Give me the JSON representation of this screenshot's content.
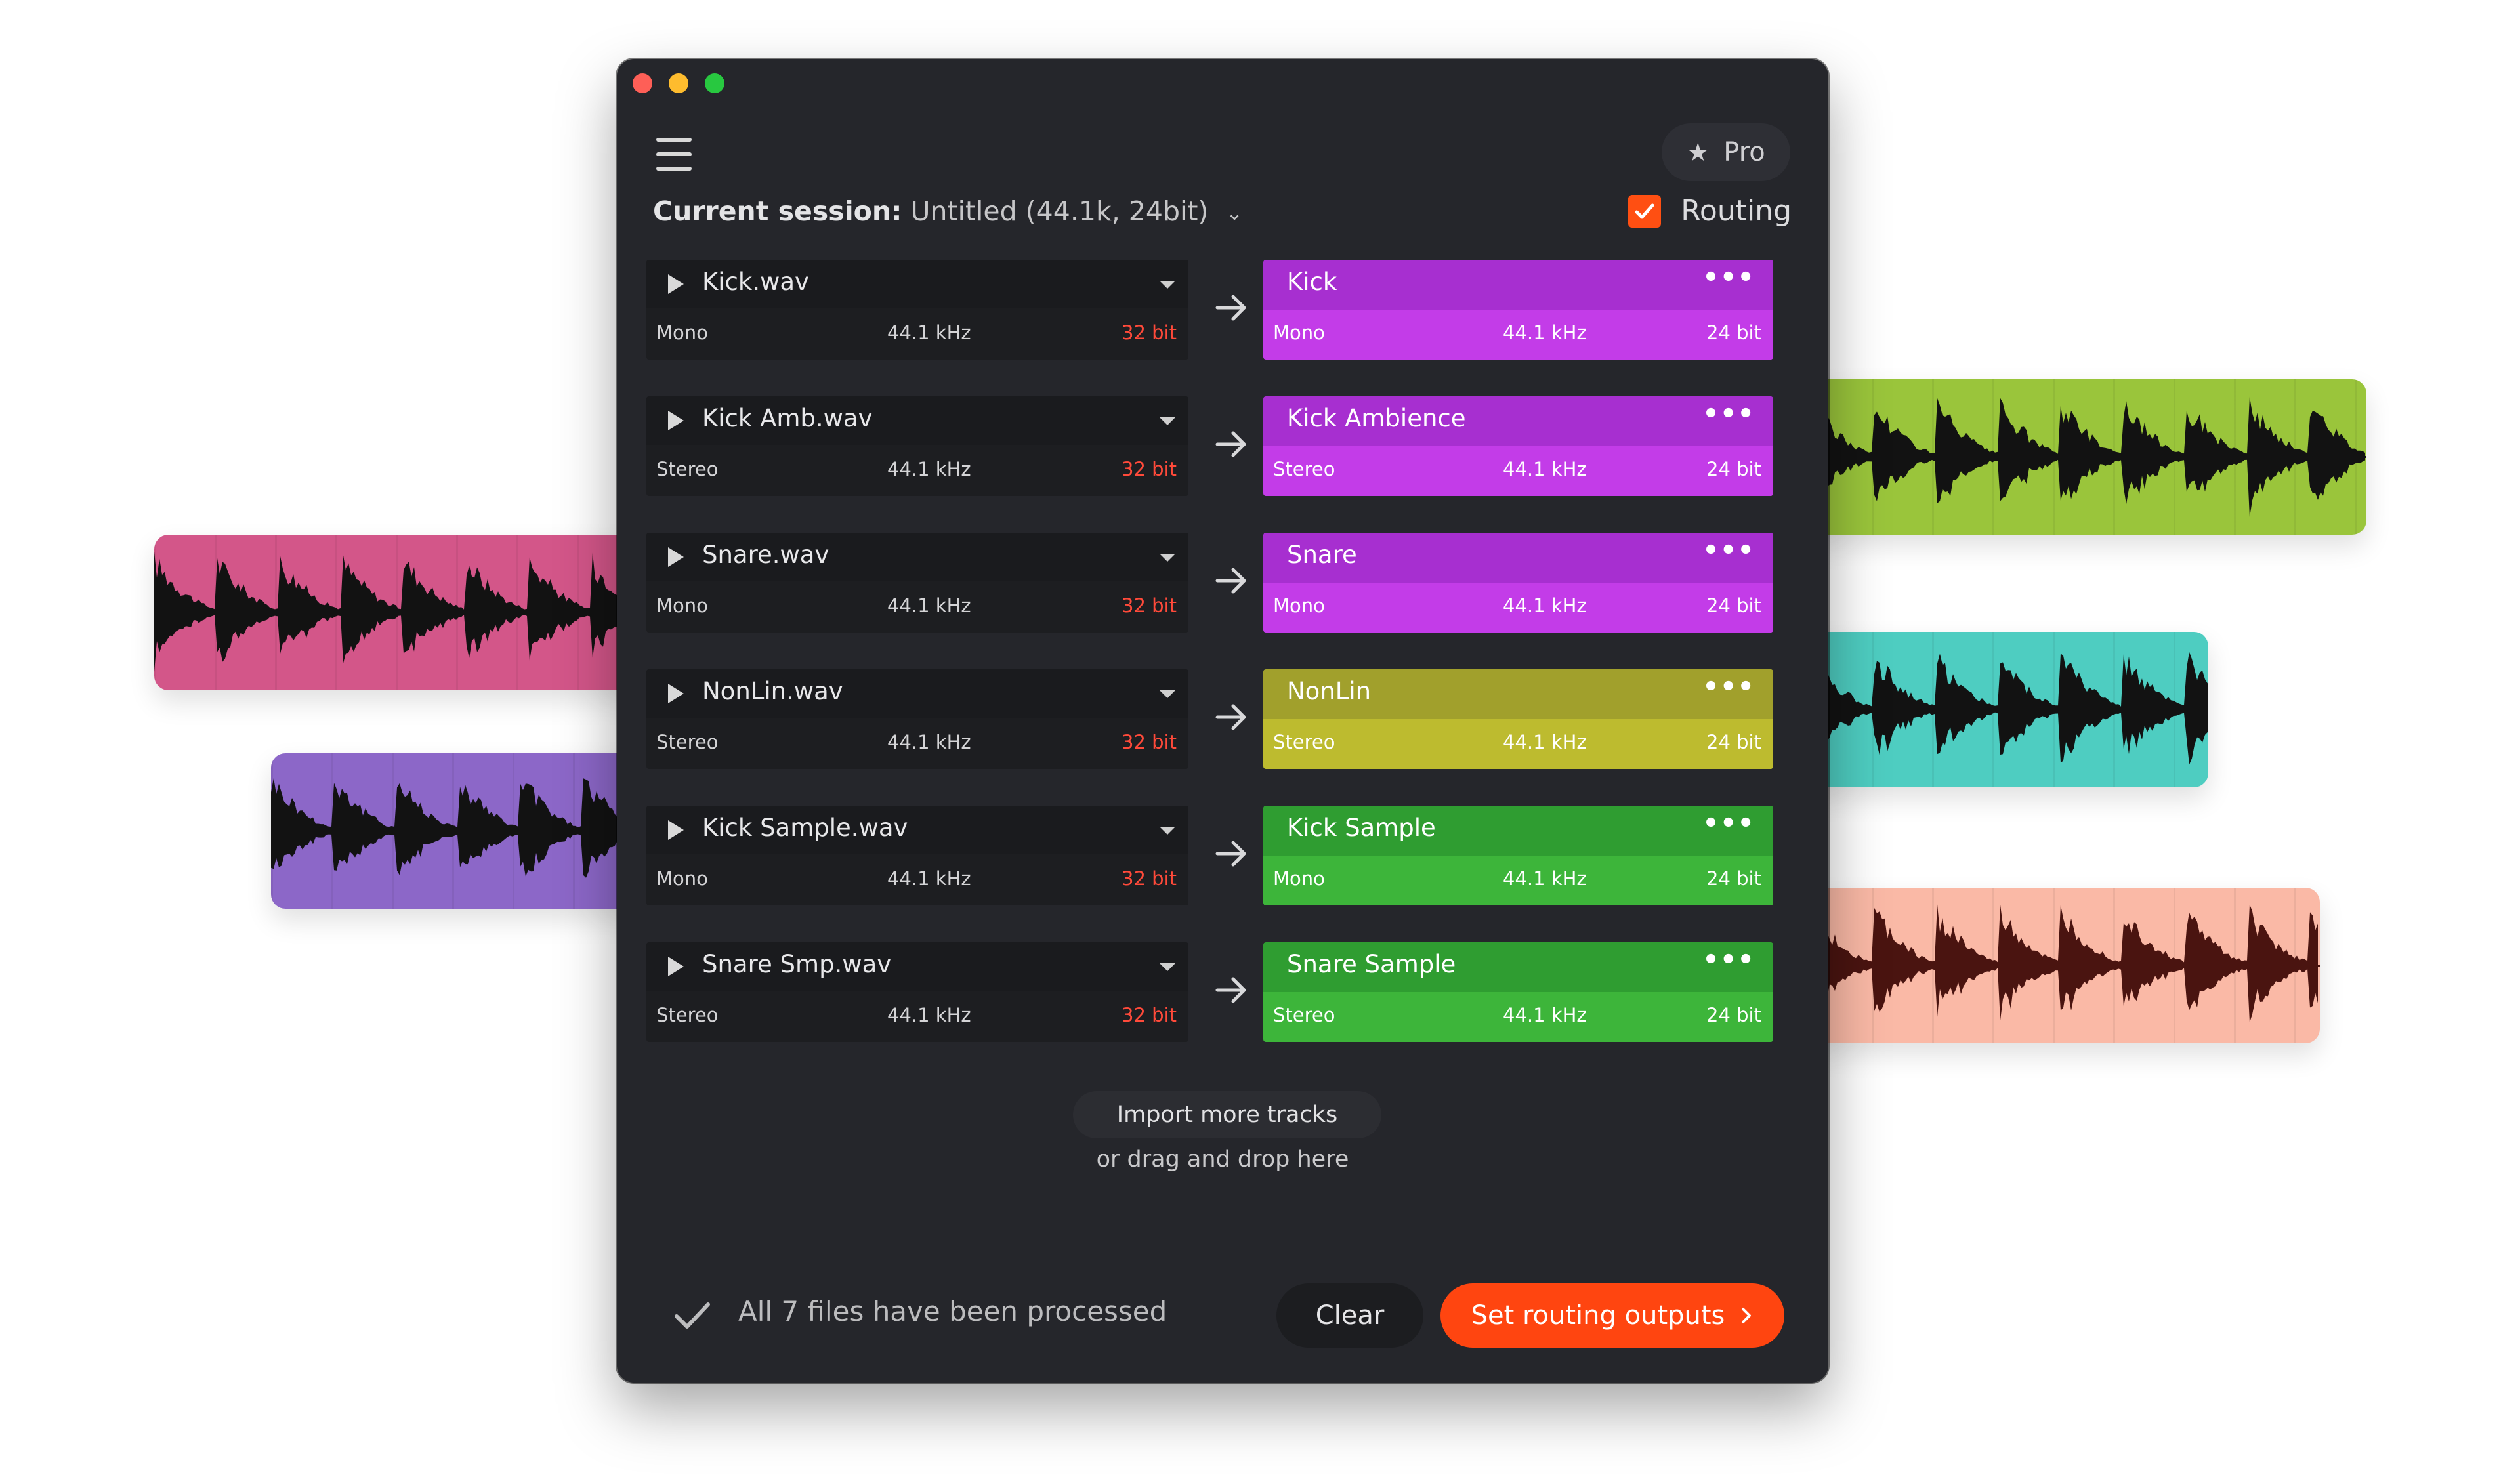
{
  "app": {
    "pro_label": "Pro",
    "star_icon": "star-icon"
  },
  "session": {
    "label": "Current session:",
    "value": "Untitled (44.1k, 24bit)"
  },
  "routing": {
    "label": "Routing",
    "checked": true,
    "accent": "#ff4f12"
  },
  "tracks": [
    {
      "file": "Kick.wav",
      "channels": "Mono",
      "rate": "44.1 kHz",
      "bits": "32 bit",
      "output": "Kick",
      "out_channels": "Mono",
      "out_rate": "44.1 kHz",
      "out_bits": "24 bit",
      "top_color": "#a72fd0",
      "bottom_color": "#c33ce8"
    },
    {
      "file": "Kick Amb.wav",
      "channels": "Stereo",
      "rate": "44.1 kHz",
      "bits": "32 bit",
      "output": "Kick Ambience",
      "out_channels": "Stereo",
      "out_rate": "44.1 kHz",
      "out_bits": "24 bit",
      "top_color": "#a72fd0",
      "bottom_color": "#c33ce8"
    },
    {
      "file": "Snare.wav",
      "channels": "Mono",
      "rate": "44.1 kHz",
      "bits": "32 bit",
      "output": "Snare",
      "out_channels": "Mono",
      "out_rate": "44.1 kHz",
      "out_bits": "24 bit",
      "top_color": "#a72fd0",
      "bottom_color": "#c33ce8"
    },
    {
      "file": "NonLin.wav",
      "channels": "Stereo",
      "rate": "44.1 kHz",
      "bits": "32 bit",
      "output": "NonLin",
      "out_channels": "Stereo",
      "out_rate": "44.1 kHz",
      "out_bits": "24 bit",
      "top_color": "#a1a02c",
      "bottom_color": "#bdbb2f"
    },
    {
      "file": "Kick Sample.wav",
      "channels": "Mono",
      "rate": "44.1 kHz",
      "bits": "32 bit",
      "output": "Kick Sample",
      "out_channels": "Mono",
      "out_rate": "44.1 kHz",
      "out_bits": "24 bit",
      "top_color": "#2f9d31",
      "bottom_color": "#3db53a"
    },
    {
      "file": "Snare Smp.wav",
      "channels": "Stereo",
      "rate": "44.1 kHz",
      "bits": "32 bit",
      "output": "Snare Sample",
      "out_channels": "Stereo",
      "out_rate": "44.1 kHz",
      "out_bits": "24 bit",
      "top_color": "#2f9d31",
      "bottom_color": "#3db53a"
    }
  ],
  "import": {
    "button": "Import more tracks",
    "hint": "or drag and drop here"
  },
  "footer": {
    "status": "All 7 files have been processed",
    "clear": "Clear",
    "set_outputs": "Set routing outputs",
    "accent": "#ff4510"
  },
  "wave_cards": [
    {
      "name": "pink",
      "color": "#d35689"
    },
    {
      "name": "purple",
      "color": "#8c67c8"
    },
    {
      "name": "lime",
      "color": "#9ac53b"
    },
    {
      "name": "teal",
      "color": "#4ecdc1"
    },
    {
      "name": "salmon",
      "color": "#fab9a6"
    }
  ]
}
